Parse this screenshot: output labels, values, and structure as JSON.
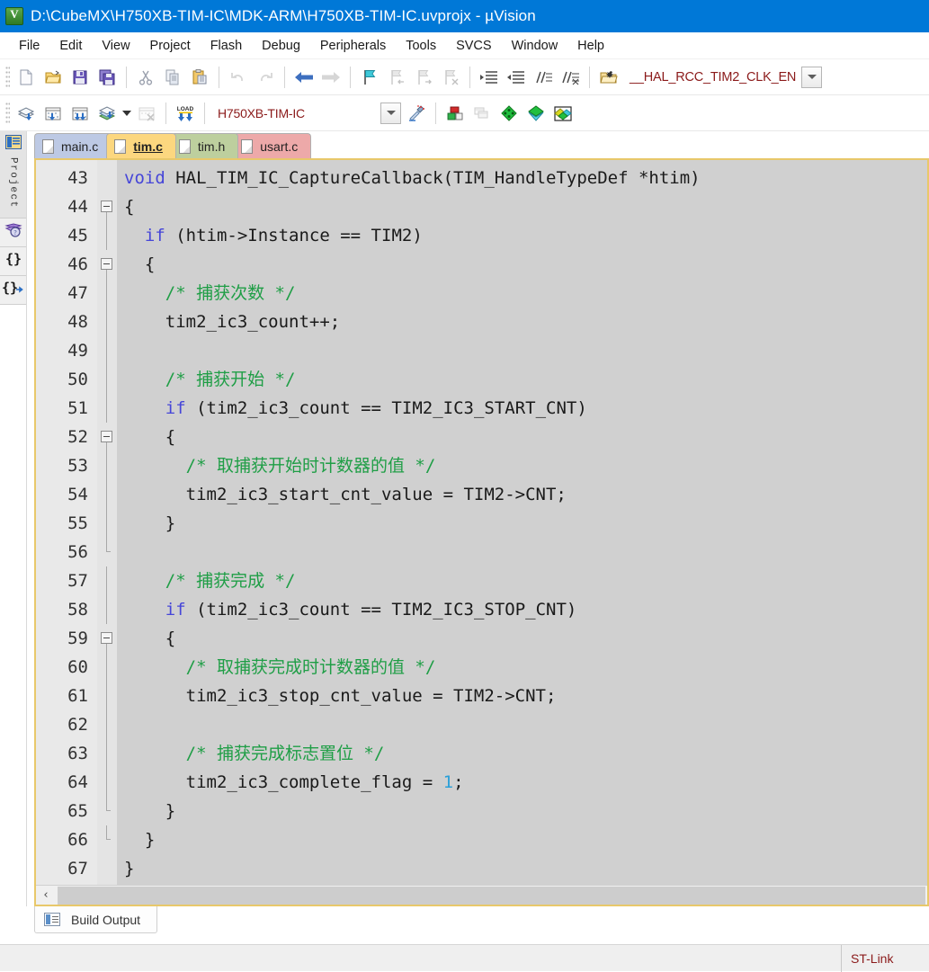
{
  "window": {
    "title": "D:\\CubeMX\\H750XB-TIM-IC\\MDK-ARM\\H750XB-TIM-IC.uvprojx - µVision",
    "app_icon": "uvision-logo-icon"
  },
  "menu": {
    "items": [
      {
        "label": "File"
      },
      {
        "label": "Edit"
      },
      {
        "label": "View"
      },
      {
        "label": "Project"
      },
      {
        "label": "Flash"
      },
      {
        "label": "Debug"
      },
      {
        "label": "Peripherals"
      },
      {
        "label": "Tools"
      },
      {
        "label": "SVCS"
      },
      {
        "label": "Window"
      },
      {
        "label": "Help"
      }
    ]
  },
  "toolbar_main": {
    "buttons": [
      {
        "name": "new-file-icon",
        "tip": "New"
      },
      {
        "name": "open-file-icon",
        "tip": "Open"
      },
      {
        "name": "save-icon",
        "tip": "Save"
      },
      {
        "name": "save-all-icon",
        "tip": "Save All"
      },
      {
        "name": "cut-icon",
        "tip": "Cut"
      },
      {
        "name": "copy-icon",
        "tip": "Copy"
      },
      {
        "name": "paste-icon",
        "tip": "Paste"
      },
      {
        "name": "undo-icon",
        "tip": "Undo"
      },
      {
        "name": "redo-icon",
        "tip": "Redo"
      },
      {
        "name": "navigate-back-icon",
        "tip": "Back"
      },
      {
        "name": "navigate-forward-icon",
        "tip": "Forward"
      },
      {
        "name": "toggle-bookmark-icon",
        "tip": "Insert/Remove Bookmark"
      },
      {
        "name": "previous-bookmark-icon",
        "tip": "Previous Bookmark"
      },
      {
        "name": "next-bookmark-icon",
        "tip": "Next Bookmark"
      },
      {
        "name": "clear-bookmarks-icon",
        "tip": "Clear All Bookmarks"
      },
      {
        "name": "indent-icon",
        "tip": "Indent Selected Text"
      },
      {
        "name": "outdent-icon",
        "tip": "Outdent Selected Text"
      },
      {
        "name": "comment-icon",
        "tip": "Comment Selection"
      },
      {
        "name": "uncomment-icon",
        "tip": "Uncomment Selection"
      },
      {
        "name": "find-in-files-icon",
        "tip": "Find in Files"
      }
    ],
    "search_combo_value": "__HAL_RCC_TIM2_CLK_EN"
  },
  "toolbar_build": {
    "buttons": [
      {
        "name": "translate-icon",
        "tip": "Translate Current File"
      },
      {
        "name": "build-target-icon",
        "tip": "Build"
      },
      {
        "name": "rebuild-all-icon",
        "tip": "Rebuild"
      },
      {
        "name": "batch-build-icon",
        "tip": "Batch Build"
      },
      {
        "name": "stop-build-icon",
        "tip": "Stop Build"
      },
      {
        "name": "download-icon",
        "tip": "Download"
      },
      {
        "name": "target-options-icon",
        "tip": "Options for Target"
      },
      {
        "name": "manage-components-icon",
        "tip": "Manage Project Items"
      },
      {
        "name": "multi-project-icon",
        "tip": "Multi-Project"
      },
      {
        "name": "pack-installer-icon",
        "tip": "Pack Installer"
      },
      {
        "name": "manage-run-env-icon",
        "tip": "Manage Run-Time Environment"
      }
    ],
    "target_combo_value": "H750XB-TIM-IC"
  },
  "left_dock": {
    "tabs": [
      {
        "label": "Project",
        "icon": "project-window-icon",
        "active": true
      },
      {
        "label": "",
        "icon": "books-icon",
        "active": false
      },
      {
        "label": "",
        "icon": "functions-icon",
        "active": false
      },
      {
        "label": "",
        "icon": "templates-icon",
        "active": false
      }
    ]
  },
  "editor": {
    "tabs": [
      {
        "label": "main.c",
        "style": "main",
        "active": false
      },
      {
        "label": "tim.c",
        "style": "active",
        "active": true
      },
      {
        "label": "tim.h",
        "style": "h",
        "active": false
      },
      {
        "label": "usart.c",
        "style": "usart",
        "active": false
      }
    ],
    "first_line": 43,
    "lines": [
      {
        "n": 43,
        "fold": "start",
        "tokens": [
          {
            "t": "void ",
            "c": "kw"
          },
          {
            "t": "HAL_TIM_IC_CaptureCallback(TIM_HandleTypeDef *htim)",
            "c": ""
          }
        ]
      },
      {
        "n": 44,
        "fold": "box",
        "tokens": [
          {
            "t": "{",
            "c": ""
          }
        ]
      },
      {
        "n": 45,
        "fold": "line",
        "tokens": [
          {
            "t": "  ",
            "c": ""
          },
          {
            "t": "if",
            "c": "kw"
          },
          {
            "t": " (htim->Instance == TIM2)",
            "c": ""
          }
        ]
      },
      {
        "n": 46,
        "fold": "box",
        "tokens": [
          {
            "t": "  {",
            "c": ""
          }
        ]
      },
      {
        "n": 47,
        "fold": "line",
        "tokens": [
          {
            "t": "    ",
            "c": ""
          },
          {
            "t": "/* 捕获次数 */",
            "c": "cmt"
          }
        ]
      },
      {
        "n": 48,
        "fold": "line",
        "tokens": [
          {
            "t": "    tim2_ic3_count++;",
            "c": ""
          }
        ]
      },
      {
        "n": 49,
        "fold": "line",
        "tokens": [
          {
            "t": "",
            "c": ""
          }
        ]
      },
      {
        "n": 50,
        "fold": "line",
        "tokens": [
          {
            "t": "    ",
            "c": ""
          },
          {
            "t": "/* 捕获开始 */",
            "c": "cmt"
          }
        ]
      },
      {
        "n": 51,
        "fold": "line",
        "tokens": [
          {
            "t": "    ",
            "c": ""
          },
          {
            "t": "if",
            "c": "kw"
          },
          {
            "t": " (tim2_ic3_count == TIM2_IC3_START_CNT)",
            "c": ""
          }
        ]
      },
      {
        "n": 52,
        "fold": "box",
        "tokens": [
          {
            "t": "    {",
            "c": ""
          }
        ]
      },
      {
        "n": 53,
        "fold": "line",
        "tokens": [
          {
            "t": "      ",
            "c": ""
          },
          {
            "t": "/* 取捕获开始时计数器的值 */",
            "c": "cmt"
          }
        ]
      },
      {
        "n": 54,
        "fold": "line",
        "tokens": [
          {
            "t": "      tim2_ic3_start_cnt_value = TIM2->CNT;",
            "c": ""
          }
        ]
      },
      {
        "n": 55,
        "fold": "end",
        "tokens": [
          {
            "t": "    }",
            "c": ""
          }
        ]
      },
      {
        "n": 56,
        "fold": "end-tick",
        "tokens": [
          {
            "t": "",
            "c": ""
          }
        ]
      },
      {
        "n": 57,
        "fold": "line",
        "tokens": [
          {
            "t": "    ",
            "c": ""
          },
          {
            "t": "/* 捕获完成 */",
            "c": "cmt"
          }
        ]
      },
      {
        "n": 58,
        "fold": "line",
        "tokens": [
          {
            "t": "    ",
            "c": ""
          },
          {
            "t": "if",
            "c": "kw"
          },
          {
            "t": " (tim2_ic3_count == TIM2_IC3_STOP_CNT)",
            "c": ""
          }
        ]
      },
      {
        "n": 59,
        "fold": "box",
        "tokens": [
          {
            "t": "    {",
            "c": ""
          }
        ]
      },
      {
        "n": 60,
        "fold": "line",
        "tokens": [
          {
            "t": "      ",
            "c": ""
          },
          {
            "t": "/* 取捕获完成时计数器的值 */",
            "c": "cmt"
          }
        ]
      },
      {
        "n": 61,
        "fold": "line",
        "tokens": [
          {
            "t": "      tim2_ic3_stop_cnt_value = TIM2->CNT;",
            "c": ""
          }
        ]
      },
      {
        "n": 62,
        "fold": "line",
        "tokens": [
          {
            "t": "",
            "c": ""
          }
        ]
      },
      {
        "n": 63,
        "fold": "line",
        "tokens": [
          {
            "t": "      ",
            "c": ""
          },
          {
            "t": "/* 捕获完成标志置位 */",
            "c": "cmt"
          }
        ]
      },
      {
        "n": 64,
        "fold": "line",
        "tokens": [
          {
            "t": "      tim2_ic3_complete_flag = ",
            "c": ""
          },
          {
            "t": "1",
            "c": "num"
          },
          {
            "t": ";",
            "c": ""
          }
        ]
      },
      {
        "n": 65,
        "fold": "end-tick",
        "tokens": [
          {
            "t": "    }",
            "c": ""
          }
        ]
      },
      {
        "n": 66,
        "fold": "end-tick",
        "tokens": [
          {
            "t": "  }",
            "c": ""
          }
        ]
      },
      {
        "n": 67,
        "fold": "none",
        "tokens": [
          {
            "t": "}",
            "c": ""
          }
        ]
      }
    ]
  },
  "scrollbar": {
    "left_arrow": "‹"
  },
  "bottom_dock": {
    "tab_label": "Build Output",
    "tab_icon": "build-output-icon"
  },
  "statusbar": {
    "right_text": "ST-Link"
  },
  "colors": {
    "titlebar": "#0078d7",
    "accent_tab_active": "#fcd77f",
    "code_background": "#d0d0d0",
    "comment_green": "#1f9e46",
    "keyword_blue": "#4646d8",
    "number_cyan": "#2aa0d8",
    "combo_text": "#8b1a1a"
  }
}
